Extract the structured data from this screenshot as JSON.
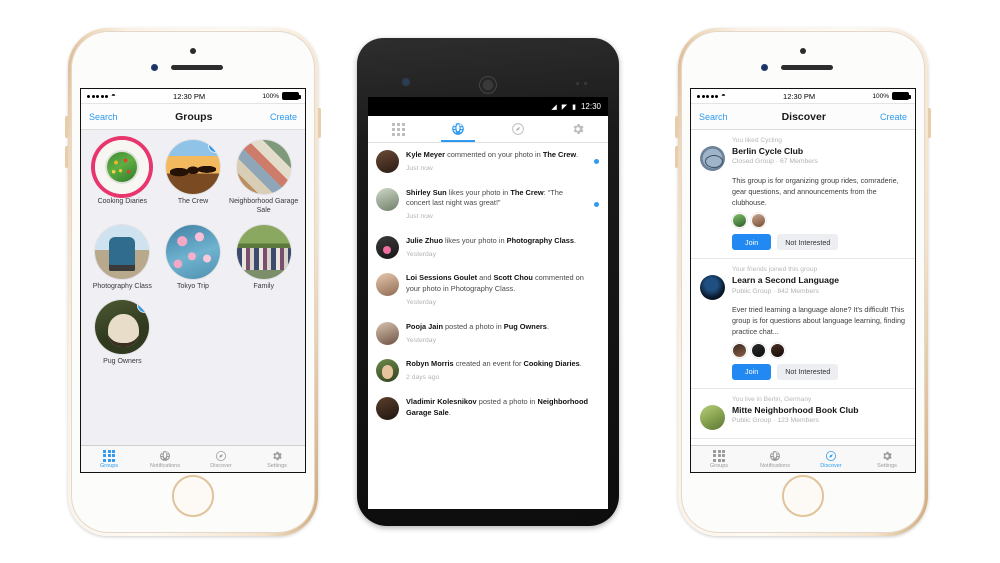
{
  "phone1": {
    "device": "iphone-gold",
    "status_bar": {
      "carrier_dots": 5,
      "wifi_icon": "wifi-icon",
      "time": "12:30 PM",
      "battery_pct": "100%"
    },
    "nav": {
      "left": "Search",
      "title": "Groups",
      "right": "Create"
    },
    "groups": [
      {
        "name": "Cooking Diaries",
        "avatar": "av-cooking",
        "ring": true,
        "badge": ""
      },
      {
        "name": "The Crew",
        "avatar": "av-crew",
        "ring": false,
        "badge": "1"
      },
      {
        "name": "Neighborhood Garage Sale",
        "avatar": "av-garage",
        "ring": false,
        "badge": ""
      },
      {
        "name": "Photography Class",
        "avatar": "av-photo",
        "ring": false,
        "badge": ""
      },
      {
        "name": "Tokyo Trip",
        "avatar": "av-tokyo",
        "ring": false,
        "badge": ""
      },
      {
        "name": "Family",
        "avatar": "av-family",
        "ring": false,
        "badge": ""
      },
      {
        "name": "Pug Owners",
        "avatar": "av-pug",
        "ring": false,
        "badge": "3"
      }
    ],
    "tabbar": [
      {
        "label": "Groups",
        "icon": "grid-icon",
        "active": true
      },
      {
        "label": "Notifications",
        "icon": "globe-icon",
        "active": false
      },
      {
        "label": "Discover",
        "icon": "compass-icon",
        "active": false
      },
      {
        "label": "Settings",
        "icon": "gear-icon",
        "active": false
      }
    ]
  },
  "phone2": {
    "device": "android-nexus",
    "status_bar": {
      "wifi_icon": "wifi-icon",
      "signal_icon": "signal-icon",
      "battery_icon": "battery-icon",
      "time": "12:30"
    },
    "tabs": [
      {
        "icon": "grid-icon",
        "active": false
      },
      {
        "icon": "globe-icon",
        "active": true
      },
      {
        "icon": "compass-icon",
        "active": false
      },
      {
        "icon": "gear-icon",
        "active": false
      }
    ],
    "notifications": [
      {
        "avatar": "p-kyle",
        "actor": "Kyle Meyer",
        "action": " commented on your photo in ",
        "target": "The Crew",
        "suffix": ".",
        "quote": "",
        "time": "Just now",
        "unread": true
      },
      {
        "avatar": "p-shirley",
        "actor": "Shirley Sun",
        "action": " likes your photo in ",
        "target": "The Crew",
        "suffix": ": “The concert last night was great!”",
        "quote": "",
        "time": "Just now",
        "unread": true
      },
      {
        "avatar": "p-julie",
        "actor": "Julie Zhuo",
        "action": " likes your photo in ",
        "target": "Photography Class",
        "suffix": ".",
        "quote": "",
        "time": "Yesterday",
        "unread": false
      },
      {
        "avatar": "p-loi",
        "actor": "Loi Sessions Goulet",
        "action": " and ",
        "target": "Scott Chou",
        "suffix": " commented on your photo in Photography Class.",
        "quote": "",
        "time": "Yesterday",
        "unread": false
      },
      {
        "avatar": "p-pooja",
        "actor": "Pooja Jain",
        "action": " posted a photo in ",
        "target": "Pug Owners",
        "suffix": ".",
        "quote": "",
        "time": "Yesterday",
        "unread": false
      },
      {
        "avatar": "p-robyn",
        "actor": "Robyn Morris",
        "action": " created an event for ",
        "target": "Cooking Diaries",
        "suffix": ".",
        "quote": "",
        "time": "2 days ago",
        "unread": false
      },
      {
        "avatar": "p-vlad",
        "actor": "Vladimir Kolesnikov",
        "action": " posted a photo in ",
        "target": "Neighborhood Garage Sale",
        "suffix": ".",
        "quote": "",
        "time": "",
        "unread": false
      }
    ]
  },
  "phone3": {
    "device": "iphone-gold",
    "status_bar": {
      "carrier_dots": 5,
      "wifi_icon": "wifi-icon",
      "time": "12:30 PM",
      "battery_pct": "100%"
    },
    "nav": {
      "left": "Search",
      "title": "Discover",
      "right": "Create"
    },
    "cards": [
      {
        "context": "You liked Cycling",
        "name": "Berlin Cycle Club",
        "meta": "Closed Group · 67 Members",
        "description": "This group is for organizing group rides, comraderie, gear questions, and announcements from the clubhouse.",
        "avatar": "av-berlin",
        "faces": [
          "f-a",
          "f-c"
        ],
        "join_label": "Join",
        "reject_label": "Not Interested"
      },
      {
        "context": "Your friends joined this group",
        "name": "Learn a Second Language",
        "meta": "Public Group · 842 Members",
        "description": "Ever tried learning a language alone? It's difficult! This group is for questions about language learning, finding practice chat...",
        "avatar": "av-lang",
        "faces": [
          "f-b",
          "f-d",
          "f-e"
        ],
        "join_label": "Join",
        "reject_label": "Not Interested"
      },
      {
        "context": "You live in Berlin, Germany",
        "name": "Mitte Neighborhood Book Club",
        "meta": "Public Group · 123 Members",
        "description": "",
        "avatar": "av-book",
        "faces": [],
        "join_label": "",
        "reject_label": ""
      }
    ],
    "tabbar": [
      {
        "label": "Groups",
        "icon": "grid-icon",
        "active": false
      },
      {
        "label": "Notifications",
        "icon": "globe-icon",
        "active": false
      },
      {
        "label": "Discover",
        "icon": "compass-icon",
        "active": true
      },
      {
        "label": "Settings",
        "icon": "gear-icon",
        "active": false
      }
    ]
  },
  "colors": {
    "accent_blue": "#2e9bf0",
    "join_blue": "#2289f2",
    "ring_pink": "#e8356d",
    "muted": "#b4b4b4"
  }
}
